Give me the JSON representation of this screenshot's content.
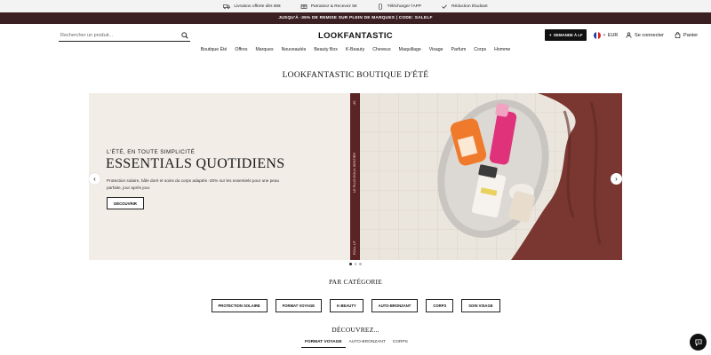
{
  "info_bar": [
    {
      "icon": "truck-icon",
      "label": "Livraison offerte dès 60€"
    },
    {
      "icon": "gift-card-icon",
      "label": "Parrainez & Recevez 5€"
    },
    {
      "icon": "phone-icon",
      "label": "Télécharger l'APP"
    },
    {
      "icon": "check-icon",
      "label": "Réduction Étudiant"
    }
  ],
  "promo": {
    "text": "JUSQU'À -35% DE REMISE SUR PLEIN DE MARQUES | CODE: SALELF"
  },
  "header": {
    "search_placeholder": "Rechercher un produit...",
    "logo": "LOOKFANTASTIC",
    "lf_button": "DEMANDE À LF",
    "currency": "EUR",
    "currency_separator": "•",
    "account": "Se connecter",
    "cart": "Panier"
  },
  "nav": [
    "Boutique Été",
    "Offres",
    "Marques",
    "Nouveautés",
    "Beauty Box",
    "K-Beauty",
    "Cheveux",
    "Maquillage",
    "Visage",
    "Parfum",
    "Corps",
    "Homme"
  ],
  "page_title": "LOOKFANTASTIC BOUTIQUE D'ÉTÉ",
  "hero": {
    "subtitle": "L'ÉTÉ, EN TOUTE SIMPLICITÉ",
    "title": "ESSENTIALS QUOTIDIENS",
    "description": "Protection solaire, hâle doré et soins du corps adaptés -20% sur les essentiels pour une peau parfaite, jour après jour.",
    "button": "DÉCOUVRIR",
    "strip_top": "-35",
    "strip_middle": "LE PLUS DOUX SENTIER",
    "strip_bottom": "ROLL UT",
    "slide_count": 3,
    "active_slide": 1
  },
  "categories": {
    "title": "PAR CATÉGORIE",
    "items": [
      "PROTECTION SOLAIRE",
      "FORMAT VOYAGE",
      "K-BEAUTY",
      "AUTO-BRONZANT",
      "CORPS",
      "SOIN VISAGE"
    ]
  },
  "discover": {
    "title": "DÉCOUVREZ...",
    "tabs": [
      "FORMAT VOYAGE",
      "AUTO-BRONZANT",
      "CORPS"
    ],
    "active_tab": 0
  },
  "colors": {
    "promo_bg": "#3a1f23",
    "strip_bg": "#5a2324",
    "towel": "#7a3731"
  }
}
